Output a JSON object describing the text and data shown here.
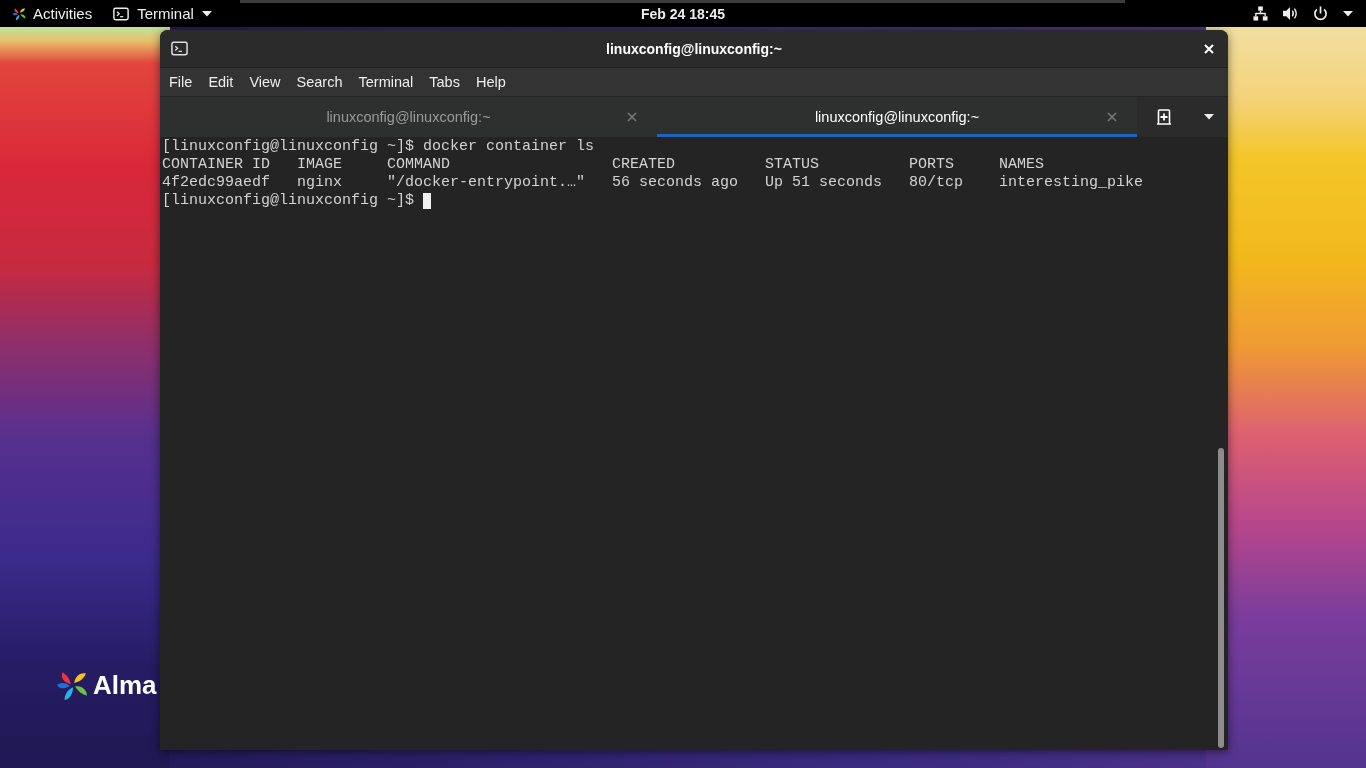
{
  "top_bar": {
    "activities": "Activities",
    "app_menu": "Terminal",
    "clock": "Feb 24 18:45"
  },
  "desktop": {
    "logo_text": "Alma"
  },
  "window": {
    "title": "linuxconfig@linuxconfig:~",
    "menu": [
      "File",
      "Edit",
      "View",
      "Search",
      "Terminal",
      "Tabs",
      "Help"
    ],
    "tabs": [
      {
        "label": "linuxconfig@linuxconfig:~",
        "selected": false
      },
      {
        "label": "linuxconfig@linuxconfig:~",
        "selected": true
      }
    ]
  },
  "terminal": {
    "lines": [
      {
        "kind": "command",
        "prompt": "[linuxconfig@linuxconfig ~]$",
        "command": "docker container ls"
      },
      {
        "kind": "table_header",
        "cells": [
          "CONTAINER ID",
          "IMAGE",
          "COMMAND",
          "CREATED",
          "STATUS",
          "PORTS",
          "NAMES"
        ]
      },
      {
        "kind": "table_row",
        "cells": [
          "4f2edc99aedf",
          "nginx",
          "\"/docker-entrypoint.…\"",
          "56 seconds ago",
          "Up 51 seconds",
          "80/tcp",
          "interesting_pike"
        ]
      },
      {
        "kind": "prompt",
        "prompt": "[linuxconfig@linuxconfig ~]$",
        "cursor": true
      }
    ]
  }
}
